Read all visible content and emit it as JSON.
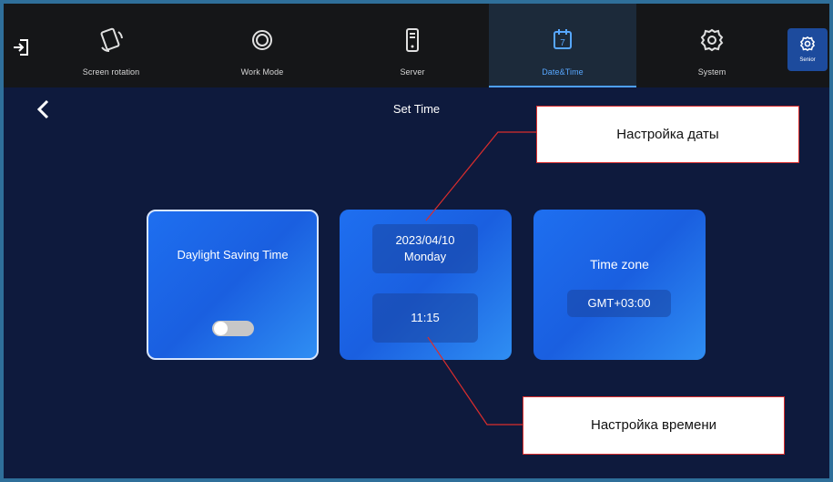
{
  "topbar": {
    "tabs": [
      {
        "label": "Screen rotation",
        "icon": "screen-rotation-icon"
      },
      {
        "label": "Work Mode",
        "icon": "work-mode-icon"
      },
      {
        "label": "Server",
        "icon": "server-icon"
      },
      {
        "label": "Date&Time",
        "icon": "calendar-icon",
        "icon_text": "7"
      },
      {
        "label": "System",
        "icon": "gear-icon"
      }
    ],
    "senior_label": "Senior",
    "active_tab": "Date&Time"
  },
  "page": {
    "title": "Set Time"
  },
  "cards": {
    "dst_label": "Daylight Saving Time",
    "dst_enabled": false,
    "date_line1": "2023/04/10",
    "date_line2": "Monday",
    "time": "11:15",
    "timezone_label": "Time zone",
    "timezone_value": "GMT+03:00"
  },
  "annotations": {
    "date_callout": "Настройка даты",
    "time_callout": "Настройка времени"
  },
  "colors": {
    "background": "#0e1a3d",
    "accent": "#4ea0ff",
    "card": "#1e6ff0",
    "callout_line": "#d92d2d"
  }
}
